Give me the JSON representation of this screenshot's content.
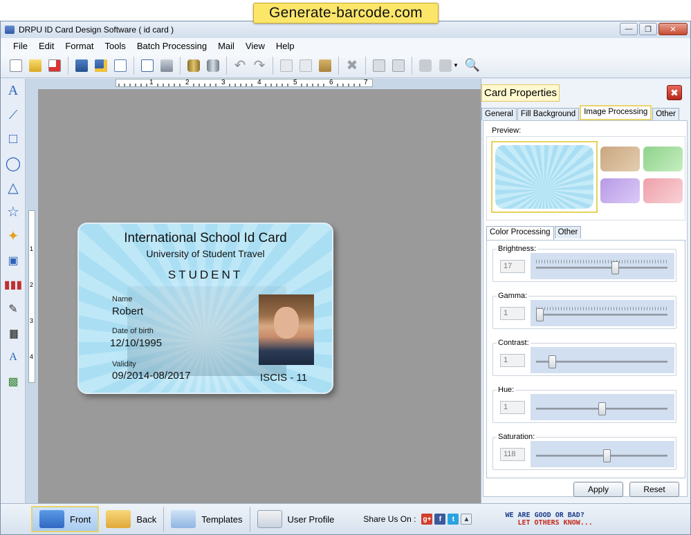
{
  "banner": "Generate-barcode.com",
  "window": {
    "title": "DRPU ID Card Design Software ( id card )"
  },
  "menu": [
    "File",
    "Edit",
    "Format",
    "Tools",
    "Batch Processing",
    "Mail",
    "View",
    "Help"
  ],
  "toolbar": [
    "new-icon",
    "open-folder-icon",
    "close-file-icon",
    "save-icon",
    "save-as-icon",
    "export-icon",
    "print-preview-icon",
    "print-icon",
    "database-icon",
    "database-export-icon",
    "undo-icon",
    "redo-icon",
    "cut-icon",
    "copy-icon",
    "paste-icon",
    "delete-icon",
    "bring-front-icon",
    "send-back-icon",
    "lock-icon",
    "unlock-icon",
    "zoom-icon"
  ],
  "left_tools": [
    "text-icon",
    "line-icon",
    "rectangle-icon",
    "ellipse-icon",
    "triangle-icon",
    "star-icon",
    "symbol-icon",
    "image-icon",
    "library-icon",
    "signature-icon",
    "barcode-icon",
    "watermark-icon",
    "picture-icon"
  ],
  "ruler": {
    "top_marks": [
      "1",
      "2",
      "3",
      "4",
      "5",
      "6",
      "7"
    ],
    "left_marks": [
      "1",
      "2",
      "3",
      "4"
    ]
  },
  "card": {
    "title": "International School Id Card",
    "subtitle": "University of Student Travel",
    "role": "STUDENT",
    "name_label": "Name",
    "name_value": "Robert",
    "dob_label": "Date of birth",
    "dob_value": "12/10/1995",
    "validity_label": "Validity",
    "validity_value": "09/2014-08/2017",
    "code": "ISCIS - 11"
  },
  "properties": {
    "title": "Card Properties",
    "tabs": [
      "General",
      "Fill Background",
      "Image Processing",
      "Other"
    ],
    "active_tab": "Image Processing",
    "preview_label": "Preview:",
    "subtabs": [
      "Color Processing",
      "Other"
    ],
    "sliders": [
      {
        "label": "Brightness:",
        "value": "17",
        "level": 0.61
      },
      {
        "label": "Gamma:",
        "value": "1",
        "level": 0.0
      },
      {
        "label": "Contrast:",
        "value": "1",
        "level": 0.1
      },
      {
        "label": "Hue:",
        "value": "1",
        "level": 0.5
      },
      {
        "label": "Saturation:",
        "value": "118",
        "level": 0.54
      }
    ],
    "apply": "Apply",
    "reset": "Reset"
  },
  "bottom": {
    "front": "Front",
    "back": "Back",
    "templates": "Templates",
    "user_profile": "User Profile",
    "share_label": "Share Us On :",
    "feedback_line1": "WE ARE GOOD OR BAD?",
    "feedback_line2": "LET OTHERS KNOW..."
  }
}
